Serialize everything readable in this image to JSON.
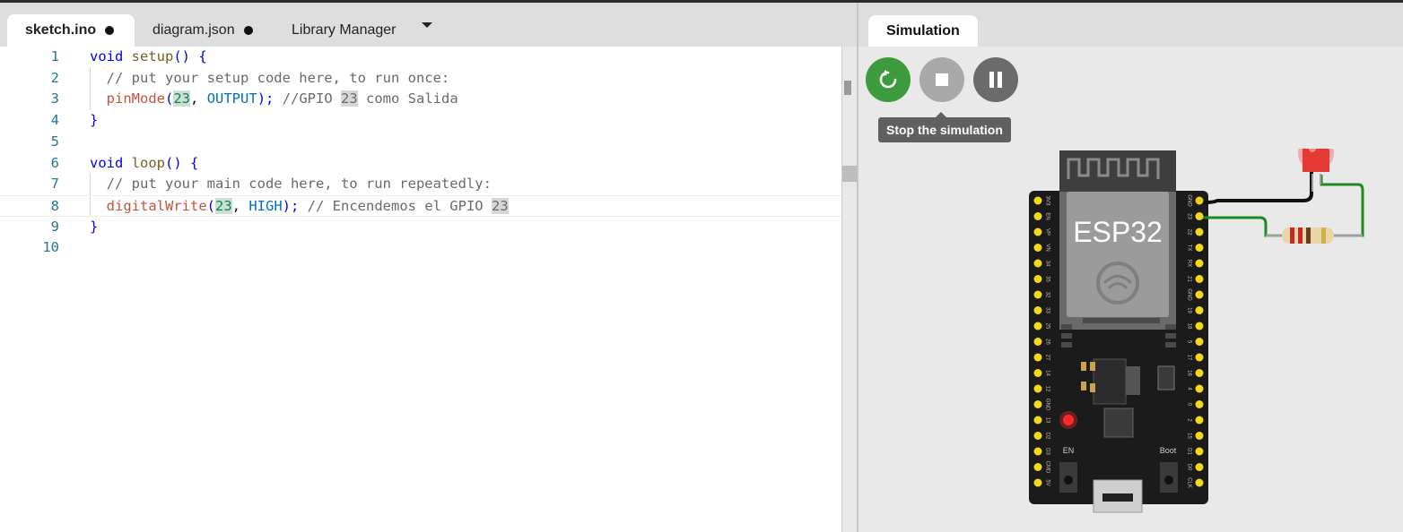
{
  "editor": {
    "tabs": [
      {
        "label": "sketch.ino",
        "modified": true
      },
      {
        "label": "diagram.json",
        "modified": true
      },
      {
        "label": "Library Manager",
        "modified": false
      }
    ]
  },
  "code": {
    "line_numbers": [
      "1",
      "2",
      "3",
      "4",
      "5",
      "6",
      "7",
      "8",
      "9",
      "10"
    ],
    "lines": [
      [
        {
          "t": "void",
          "c": "kw"
        },
        {
          "t": " setup",
          "c": "fn"
        },
        {
          "t": "() {",
          "c": "kw"
        }
      ],
      [
        {
          "t": "  // put your setup code here, to run once:",
          "c": "cm"
        }
      ],
      [
        {
          "t": "  pinMode",
          "c": "fn2"
        },
        {
          "t": "(",
          "c": "kw"
        },
        {
          "t": "23",
          "c": "num"
        },
        {
          "t": ", ",
          "c": "pl"
        },
        {
          "t": "OUTPUT",
          "c": "cst"
        },
        {
          "t": "); ",
          "c": "kw"
        },
        {
          "t": "//GPIO ",
          "c": "cm"
        },
        {
          "t": "23",
          "c": "hl cm"
        },
        {
          "t": " como Salida",
          "c": "cm"
        }
      ],
      [
        {
          "t": "}",
          "c": "kw"
        }
      ],
      [],
      [
        {
          "t": "void",
          "c": "kw"
        },
        {
          "t": " loop",
          "c": "fn"
        },
        {
          "t": "() {",
          "c": "kw"
        }
      ],
      [
        {
          "t": "  // put your main code here, to run repeatedly:",
          "c": "cm"
        }
      ],
      [
        {
          "t": "  digitalWrite",
          "c": "fn2"
        },
        {
          "t": "(",
          "c": "kw"
        },
        {
          "t": "23",
          "c": "num"
        },
        {
          "t": ", ",
          "c": "pl"
        },
        {
          "t": "HIGH",
          "c": "cst"
        },
        {
          "t": "); ",
          "c": "kw"
        },
        {
          "t": "// Encendemos el GPIO ",
          "c": "cm"
        },
        {
          "t": "23",
          "c": "hl cm"
        }
      ],
      [
        {
          "t": "}",
          "c": "kw"
        }
      ],
      []
    ],
    "current_line": 8
  },
  "simulation": {
    "tab_label": "Simulation",
    "restart_icon": "restart-icon",
    "stop_icon": "stop-icon",
    "pause_icon": "pause-icon",
    "tooltip": "Stop the simulation",
    "colors": {
      "restart": "#3c9b3c",
      "stop": "#a9a9a9",
      "pause": "#6b6b6b",
      "tooltip_bg": "#606060"
    }
  },
  "board": {
    "chip_label": "ESP32",
    "en_label": "EN",
    "boot_label": "Boot",
    "left_pins": [
      "3V3",
      "EN",
      "VP",
      "VN",
      "34",
      "35",
      "32",
      "33",
      "25",
      "26",
      "27",
      "14",
      "12",
      "GND",
      "13",
      "D2",
      "D3",
      "CMD",
      "5V"
    ],
    "right_pins": [
      "GND",
      "23",
      "22",
      "TX",
      "RX",
      "21",
      "GND",
      "19",
      "18",
      "5",
      "17",
      "16",
      "4",
      "0",
      "2",
      "15",
      "D1",
      "D0",
      "CLK"
    ]
  }
}
